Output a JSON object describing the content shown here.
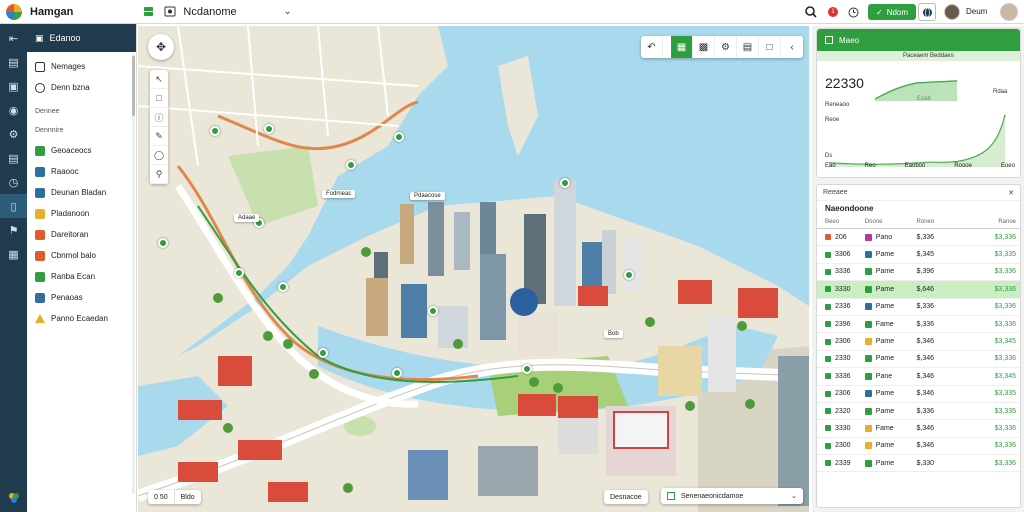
{
  "topbar": {
    "app_title": "Hamgan",
    "doc_title": "Ncdanome",
    "action_button": "Ndom",
    "notification_count": "1",
    "user_name": "Deum",
    "icons": [
      "grid-icon",
      "sheet-icon",
      "map-icon",
      "chevron-down-icon",
      "search-icon",
      "clock-icon",
      "globe-icon",
      "avatar"
    ]
  },
  "rail": {
    "icons": [
      "collapse-icon",
      "layers-icon",
      "document-icon",
      "location-icon",
      "settings-icon",
      "chart-icon",
      "clock-icon",
      "folder-icon",
      "bookmark-icon",
      "table-icon"
    ]
  },
  "sidebar": {
    "header": "Edanoo",
    "items": [
      {
        "label": "Nemages",
        "color": "#2f6f9e"
      },
      {
        "label": "Denn bzna",
        "color": "#2f6f9e"
      }
    ],
    "section_a": "Dennee",
    "section_b": "Dennnire",
    "items2": [
      {
        "label": "Geoaceocs",
        "color": "#2f9e3f"
      },
      {
        "label": "Raaooc",
        "color": "#2f6f9e"
      },
      {
        "label": "Deunan Bladan",
        "color": "#2f6f9e"
      },
      {
        "label": "Pladanoon",
        "color": "#e8b02a"
      },
      {
        "label": "Dareitoran",
        "color": "#e05a2a"
      },
      {
        "label": "Cbnmol balo",
        "color": "#e05a2a"
      },
      {
        "label": "Ranba Ecan",
        "color": "#2f9e3f"
      },
      {
        "label": "Penaoas",
        "color": "#2f6f9e"
      },
      {
        "label": "Panno Ecaedan",
        "color": "#e8b02a"
      }
    ]
  },
  "map": {
    "label_a": "Pdaacose",
    "label_b": "Fodrneac",
    "label_c": "Adaae",
    "label_d": "Bob",
    "bottom_left": [
      "0 50",
      "Bldo"
    ],
    "badge": "Desnacoe",
    "bottom_right": "Senenaeonicdamoe"
  },
  "rpanel": {
    "card1": {
      "header": "Maeo",
      "sub": "Paceaem  Beddaes",
      "big_value": "22330",
      "label1": "Reneaoo",
      "label2": "Eoab",
      "label3": "Rdaa",
      "label4": "Reoe",
      "x_labels": [
        "Eao",
        "Reo",
        "Eaoboo",
        "Roooe",
        "Eoeo"
      ],
      "label_d": "Ds"
    },
    "card2": {
      "head_left": "Reeaee",
      "title": "Naeondoone",
      "columns": [
        "Beeo",
        "Doone",
        "Roneo",
        "Ranoe"
      ],
      "rows": [
        {
          "c1": "206",
          "c2": "Pano",
          "c3": "$,336",
          "c4": "$3,336",
          "color": "#e05a2a",
          "sw": "#b03aa0",
          "hl": false
        },
        {
          "c1": "3306",
          "c2": "Pame",
          "c3": "$,345",
          "c4": "$3,335",
          "color": "#2f9e3f",
          "sw": "#2f6f9e",
          "hl": false
        },
        {
          "c1": "3336",
          "c2": "Pame",
          "c3": "$,396",
          "c4": "$3,336",
          "color": "#2f9e3f",
          "sw": "#2f9e3f",
          "hl": false
        },
        {
          "c1": "3330",
          "c2": "Pame",
          "c3": "$,646",
          "c4": "$3,336",
          "color": "#2f9e3f",
          "sw": "#2f9e3f",
          "hl": true
        },
        {
          "c1": "2336",
          "c2": "Pame",
          "c3": "$,336",
          "c4": "$3,336",
          "color": "#2f9e3f",
          "sw": "#2f6f9e",
          "hl": false
        },
        {
          "c1": "2396",
          "c2": "Fame",
          "c3": "$,336",
          "c4": "$3,336",
          "color": "#2f9e3f",
          "sw": "#2f9e3f",
          "hl": false
        },
        {
          "c1": "2306",
          "c2": "Pame",
          "c3": "$,346",
          "c4": "$3,345",
          "color": "#2f9e3f",
          "sw": "#e8b02a",
          "hl": false
        },
        {
          "c1": "2330",
          "c2": "Pame",
          "c3": "$,346",
          "c4": "$3,336",
          "color": "#2f9e3f",
          "sw": "#2f9e3f",
          "hl": false
        },
        {
          "c1": "3336",
          "c2": "Pane",
          "c3": "$,346",
          "c4": "$3,345",
          "color": "#2f9e3f",
          "sw": "#2f9e3f",
          "hl": false
        },
        {
          "c1": "2306",
          "c2": "Pame",
          "c3": "$,346",
          "c4": "$3,335",
          "color": "#2f9e3f",
          "sw": "#2f6f9e",
          "hl": false
        },
        {
          "c1": "2320",
          "c2": "Pame",
          "c3": "$,336",
          "c4": "$3,335",
          "color": "#2f9e3f",
          "sw": "#2f9e3f",
          "hl": false
        },
        {
          "c1": "3330",
          "c2": "Fame",
          "c3": "$,346",
          "c4": "$3,336",
          "color": "#2f9e3f",
          "sw": "#e8b02a",
          "hl": false
        },
        {
          "c1": "2300",
          "c2": "Pame",
          "c3": "$,346",
          "c4": "$3,336",
          "color": "#2f9e3f",
          "sw": "#e8b02a",
          "hl": false
        },
        {
          "c1": "2339",
          "c2": "Pame",
          "c3": "$,330",
          "c4": "$3,336",
          "color": "#2f9e3f",
          "sw": "#2f9e3f",
          "hl": false
        }
      ]
    }
  }
}
